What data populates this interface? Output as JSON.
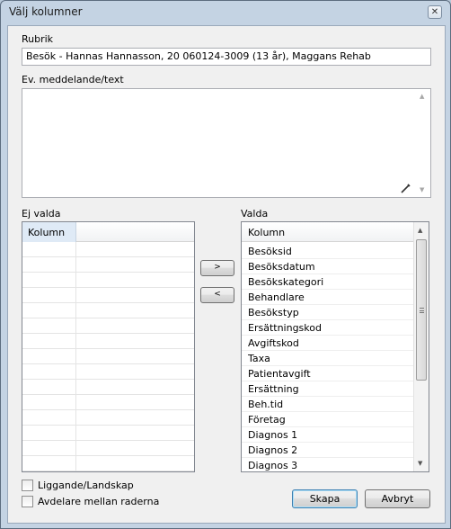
{
  "window": {
    "title": "Välj kolumner",
    "close_glyph": "✕"
  },
  "rubrik": {
    "label": "Rubrik",
    "value": "Besök - Hannas Hannasson, 20 060124-3009 (13 år), Maggans Rehab"
  },
  "message": {
    "label": "Ev. meddelande/text",
    "value": ""
  },
  "ej_valda": {
    "label": "Ej valda",
    "column_header": "Kolumn",
    "items": []
  },
  "valda": {
    "label": "Valda",
    "column_header": "Kolumn",
    "items": [
      "Besöksid",
      "Besöksdatum",
      "Besökskategori",
      "Behandlare",
      "Besökstyp",
      "Ersättningskod",
      "Avgiftskod",
      "Taxa",
      "Patientavgift",
      "Ersättning",
      "Beh.tid",
      "Företag",
      "Diagnos 1",
      "Diagnos 2",
      "Diagnos 3"
    ]
  },
  "buttons": {
    "move_right": ">",
    "move_left": "<",
    "create": "Skapa",
    "cancel": "Avbryt"
  },
  "options": {
    "landscape": {
      "label": "Liggande/Landskap",
      "checked": false
    },
    "row_dividers": {
      "label": "Avdelare mellan raderna",
      "checked": false
    }
  },
  "icons": {
    "pen": "pen-icon",
    "scroll_up": "▲",
    "scroll_down": "▼"
  }
}
